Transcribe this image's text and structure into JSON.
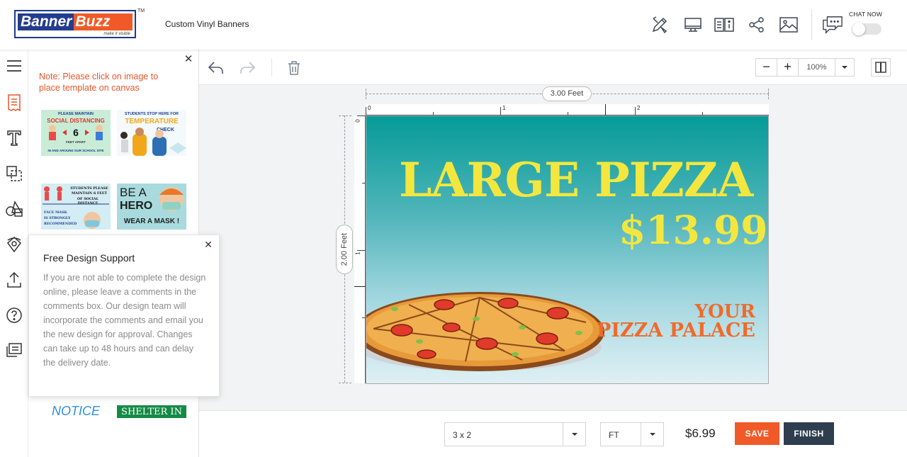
{
  "header": {
    "logo_banner": "Banner",
    "logo_buzz": "Buzz",
    "logo_tagline": "make it visible",
    "logo_tm": "TM",
    "title": "Custom Vinyl Banners",
    "icons": [
      "pencil-ruler-icon",
      "monitor-icon",
      "book-info-icon",
      "share-icon",
      "image-icon",
      "chat-icon"
    ],
    "chat_label": "CHAT NOW",
    "chat_enabled": false
  },
  "rail": {
    "icons": [
      "menu-icon",
      "template-icon",
      "text-icon",
      "layers-icon",
      "shapes-icon",
      "clipart-icon",
      "upload-icon",
      "help-icon",
      "comments-icon"
    ]
  },
  "panel": {
    "note": "Note: Please click on image to place template on canvas",
    "thumbs": {
      "t1": {
        "l1": "PLEASE MAINTAIN",
        "l2": "SOCIAL DISTANCING",
        "l3": "6",
        "l4": "FEET APART",
        "l5": "IN AND AROUND OUR SCHOOL SITE"
      },
      "t2": {
        "l1": "STUDENTS STOP HERE FOR",
        "l2": "TEMPERATURE",
        "l3": "CHECK"
      },
      "t3": {
        "l1": "STUDENTS PLEASE",
        "l2": "MAINTAIN 6 FEET",
        "l3": "OF SOCIAL DISTANCE",
        "l4": "FACE MASK",
        "l5": "IS STRONGLY",
        "l6": "RECOMMENDED"
      },
      "t4": {
        "l1": "BE A",
        "l2": "HERO",
        "l3": "WEAR A MASK !"
      },
      "t5": {
        "l1": "NOTICE"
      },
      "t6": {
        "l1": "SHELTER IN"
      }
    }
  },
  "popup": {
    "title": "Free Design Support",
    "body": "If you are not able to complete the design online, please leave a comments in the comments box. Our design team will incorporate the comments and email you the new design for approval. Changes can take up to 48 hours and can delay the delivery date."
  },
  "toolbar": {
    "zoom_minus": "−",
    "zoom_plus": "+",
    "zoom_value": "100%"
  },
  "canvas": {
    "width_label": "3.00 Feet",
    "height_label": "2.00 Feet",
    "ruler_h": [
      "0",
      "1",
      "2"
    ],
    "ruler_v": [
      "0",
      "1"
    ],
    "headline": "LARGE PIZZA",
    "price": "$13.99",
    "line1": "YOUR",
    "line2": "PIZZA PALACE",
    "colors": {
      "bg_top": "#069b98",
      "bg_bottom": "#dff0f4",
      "headline": "#f3e73f",
      "tagline": "#f06a2a"
    }
  },
  "bottom": {
    "size_value": "3 x 2",
    "unit_value": "FT",
    "price": "$6.99",
    "save_label": "SAVE",
    "finish_label": "FINISH",
    "save_color": "#f05a28",
    "finish_color": "#2f3e4e"
  }
}
